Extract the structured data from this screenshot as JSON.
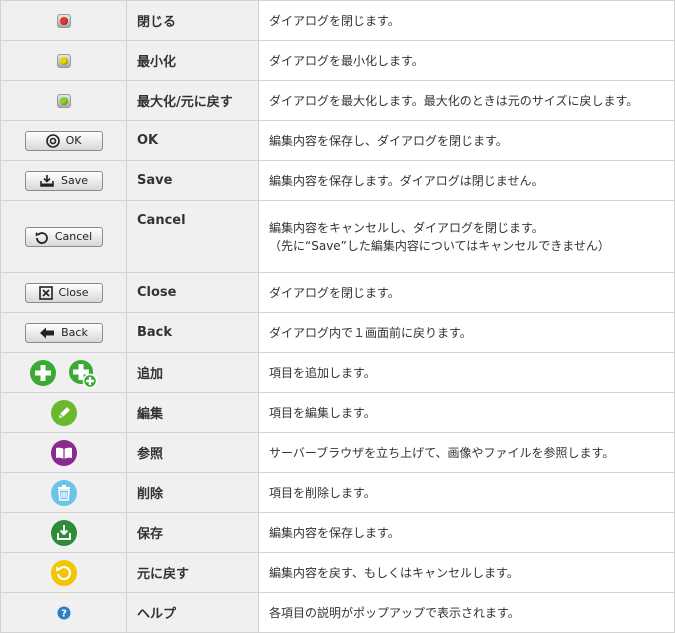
{
  "rows": [
    {
      "label": "閉じる",
      "desc": "ダイアログを閉じます。",
      "icon": "close-dot-icon",
      "color": "#e03a2e"
    },
    {
      "label": "最小化",
      "desc": "ダイアログを最小化します。",
      "icon": "minimize-dot-icon",
      "color": "#e6d400"
    },
    {
      "label": "最大化/元に戻す",
      "desc": "ダイアログを最大化します。最大化のときは元のサイズに戻します。",
      "icon": "maximize-dot-icon",
      "color": "#8ccf2a"
    },
    {
      "label": "OK",
      "desc": "編集内容を保存し、ダイアログを閉じます。",
      "button": "OK",
      "icon": "ok-icon"
    },
    {
      "label": "Save",
      "desc": "編集内容を保存します。ダイアログは閉じません。",
      "button": "Save",
      "icon": "save-icon"
    },
    {
      "label": "Cancel",
      "desc": "編集内容をキャンセルし、ダイアログを閉じます。",
      "desc2": "（先に“Save”した編集内容についてはキャンセルできません）",
      "button": "Cancel",
      "icon": "undo-icon"
    },
    {
      "label": "Close",
      "desc": "ダイアログを閉じます。",
      "button": "Close",
      "icon": "close-box-icon"
    },
    {
      "label": "Back",
      "desc": "ダイアログ内で１画面前に戻ります。",
      "button": "Back",
      "icon": "back-arrow-icon"
    },
    {
      "label": "追加",
      "desc": "項目を追加します。",
      "icon": "add-icon",
      "color": "#3aaa35"
    },
    {
      "label": "編集",
      "desc": "項目を編集します。",
      "icon": "pencil-icon",
      "color": "#6ab82e"
    },
    {
      "label": "参照",
      "desc": "サーバーブラウザを立ち上げて、画像やファイルを参照します。",
      "icon": "book-icon",
      "color": "#8a2a8a"
    },
    {
      "label": "削除",
      "desc": "項目を削除します。",
      "icon": "trash-icon",
      "color": "#6ec3ea"
    },
    {
      "label": "保存",
      "desc": "編集内容を保存します。",
      "icon": "save-circle-icon",
      "color": "#2e8b3a"
    },
    {
      "label": "元に戻す",
      "desc": "編集内容を戻す、もしくはキャンセルします。",
      "icon": "undo-circle-icon",
      "color": "#f2c500"
    },
    {
      "label": "ヘルプ",
      "desc": "各項目の説明がポップアップで表示されます。",
      "icon": "help-icon",
      "color": "#2a7fc8"
    }
  ]
}
